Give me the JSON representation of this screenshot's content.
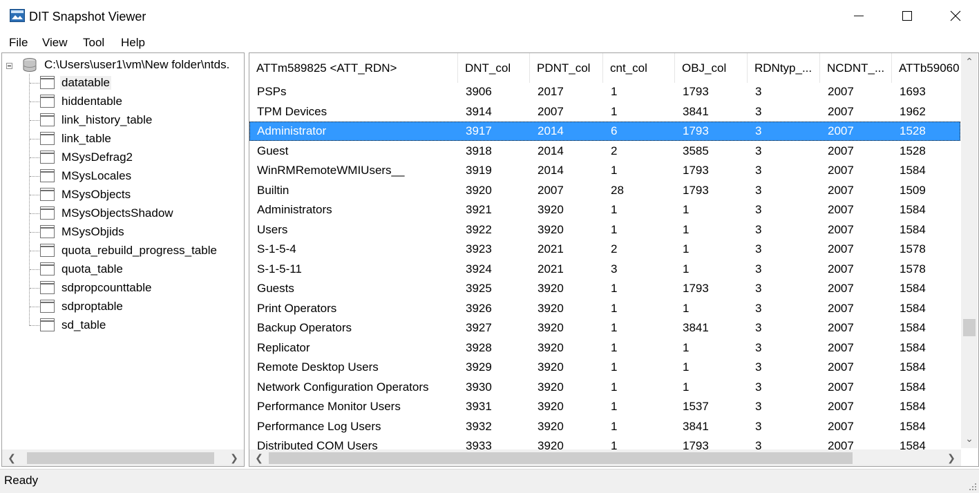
{
  "window": {
    "title": "DIT Snapshot Viewer",
    "icons": [
      "app-icon",
      "minimize-icon",
      "maximize-icon",
      "close-icon"
    ]
  },
  "menu": [
    "File",
    "View",
    "Tool",
    "Help"
  ],
  "tree": {
    "root_label": "C:\\Users\\user1\\vm\\New folder\\ntds.",
    "items": [
      "datatable",
      "hiddentable",
      "link_history_table",
      "link_table",
      "MSysDefrag2",
      "MSysLocales",
      "MSysObjects",
      "MSysObjectsShadow",
      "MSysObjids",
      "quota_rebuild_progress_table",
      "quota_table",
      "sdpropcounttable",
      "sdproptable",
      "sd_table"
    ],
    "selected": "datatable"
  },
  "grid": {
    "columns": [
      "ATTm589825 <ATT_RDN>",
      "DNT_col",
      "PDNT_col",
      "cnt_col",
      "OBJ_col",
      "RDNtyp_...",
      "NCDNT_...",
      "ATTb59060"
    ],
    "selected_row": "Administrator",
    "rows": [
      [
        "PSPs",
        "3906",
        "2017",
        "1",
        "1793",
        "3",
        "2007",
        "1693"
      ],
      [
        "TPM Devices",
        "3914",
        "2007",
        "1",
        "3841",
        "3",
        "2007",
        "1962"
      ],
      [
        "Administrator",
        "3917",
        "2014",
        "6",
        "1793",
        "3",
        "2007",
        "1528"
      ],
      [
        "Guest",
        "3918",
        "2014",
        "2",
        "3585",
        "3",
        "2007",
        "1528"
      ],
      [
        "WinRMRemoteWMIUsers__",
        "3919",
        "2014",
        "1",
        "1793",
        "3",
        "2007",
        "1584"
      ],
      [
        "Builtin",
        "3920",
        "2007",
        "28",
        "1793",
        "3",
        "2007",
        "1509"
      ],
      [
        "Administrators",
        "3921",
        "3920",
        "1",
        "1",
        "3",
        "2007",
        "1584"
      ],
      [
        "Users",
        "3922",
        "3920",
        "1",
        "1",
        "3",
        "2007",
        "1584"
      ],
      [
        "S-1-5-4",
        "3923",
        "2021",
        "2",
        "1",
        "3",
        "2007",
        "1578"
      ],
      [
        "S-1-5-11",
        "3924",
        "2021",
        "3",
        "1",
        "3",
        "2007",
        "1578"
      ],
      [
        "Guests",
        "3925",
        "3920",
        "1",
        "1793",
        "3",
        "2007",
        "1584"
      ],
      [
        "Print Operators",
        "3926",
        "3920",
        "1",
        "1",
        "3",
        "2007",
        "1584"
      ],
      [
        "Backup Operators",
        "3927",
        "3920",
        "1",
        "3841",
        "3",
        "2007",
        "1584"
      ],
      [
        "Replicator",
        "3928",
        "3920",
        "1",
        "1",
        "3",
        "2007",
        "1584"
      ],
      [
        "Remote Desktop Users",
        "3929",
        "3920",
        "1",
        "1",
        "3",
        "2007",
        "1584"
      ],
      [
        "Network Configuration Operators",
        "3930",
        "3920",
        "1",
        "1",
        "3",
        "2007",
        "1584"
      ],
      [
        "Performance Monitor Users",
        "3931",
        "3920",
        "1",
        "1537",
        "3",
        "2007",
        "1584"
      ],
      [
        "Performance Log Users",
        "3932",
        "3920",
        "1",
        "3841",
        "3",
        "2007",
        "1584"
      ],
      [
        "Distributed COM Users",
        "3933",
        "3920",
        "1",
        "1793",
        "3",
        "2007",
        "1584"
      ]
    ]
  },
  "status": {
    "text": "Ready"
  },
  "colors": {
    "selection": "#3399ff",
    "chrome": "#f0f0f0",
    "scroll_thumb": "#cdcdcd"
  }
}
